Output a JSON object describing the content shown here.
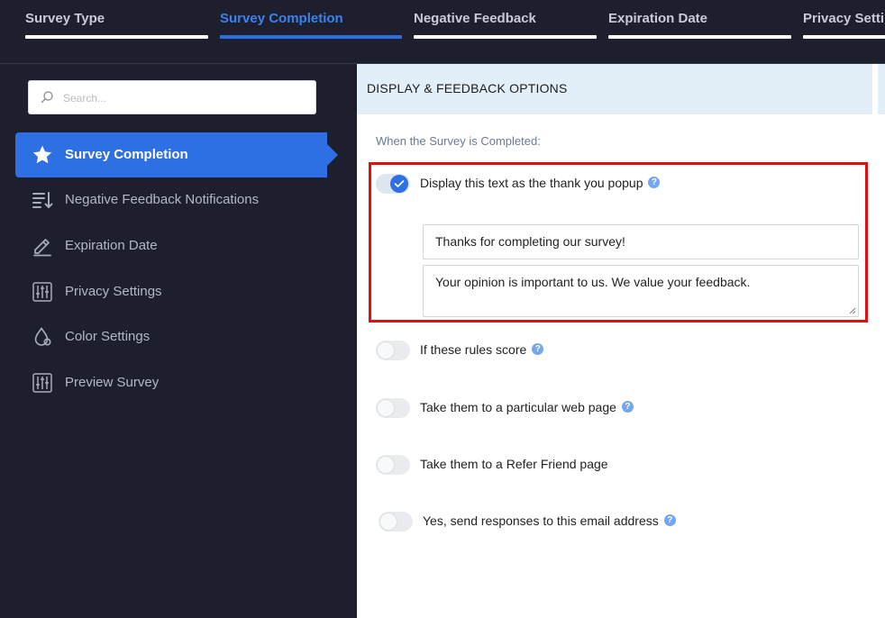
{
  "tabs": [
    {
      "label": "Survey Type",
      "active": false
    },
    {
      "label": "Survey Completion",
      "active": true
    },
    {
      "label": "Negative Feedback",
      "active": false
    },
    {
      "label": "Expiration Date",
      "active": false
    },
    {
      "label": "Privacy Settings",
      "active": false
    }
  ],
  "sidebar": {
    "search_placeholder": "Search...",
    "items": [
      {
        "label": "Survey Completion",
        "icon": "star-icon",
        "active": true
      },
      {
        "label": "Negative Feedback Notifications",
        "icon": "sort-list-icon",
        "active": false
      },
      {
        "label": "Expiration Date",
        "icon": "pencil-icon",
        "active": false
      },
      {
        "label": "Privacy Settings",
        "icon": "sliders-icon",
        "active": false
      },
      {
        "label": "Color Settings",
        "icon": "color-drop-icon",
        "active": false
      },
      {
        "label": "Preview Survey",
        "icon": "sliders-icon",
        "active": false
      }
    ]
  },
  "main": {
    "header": "DISPLAY & FEEDBACK OPTIONS",
    "completed_label": "When the Survey is Completed:",
    "options": [
      {
        "label": "Display this text as the thank you popup",
        "enabled": true,
        "help": "?"
      },
      {
        "label": "If these rules score",
        "enabled": false,
        "help": "?"
      },
      {
        "label": "Take them to a particular web page",
        "enabled": false,
        "help": "?"
      },
      {
        "label": "Take them to a Refer Friend page",
        "enabled": false
      },
      {
        "label": "Yes, send responses to this email address",
        "enabled": false,
        "help": "?"
      }
    ],
    "popup_title": "Thanks for completing our survey!",
    "popup_message": "Your opinion is important to us. We value your feedback."
  },
  "colors": {
    "accent": "#2f6fe4",
    "sidebar_bg": "#1e1f2e",
    "header_bg": "#e3eff8",
    "highlight": "#dd1111"
  }
}
